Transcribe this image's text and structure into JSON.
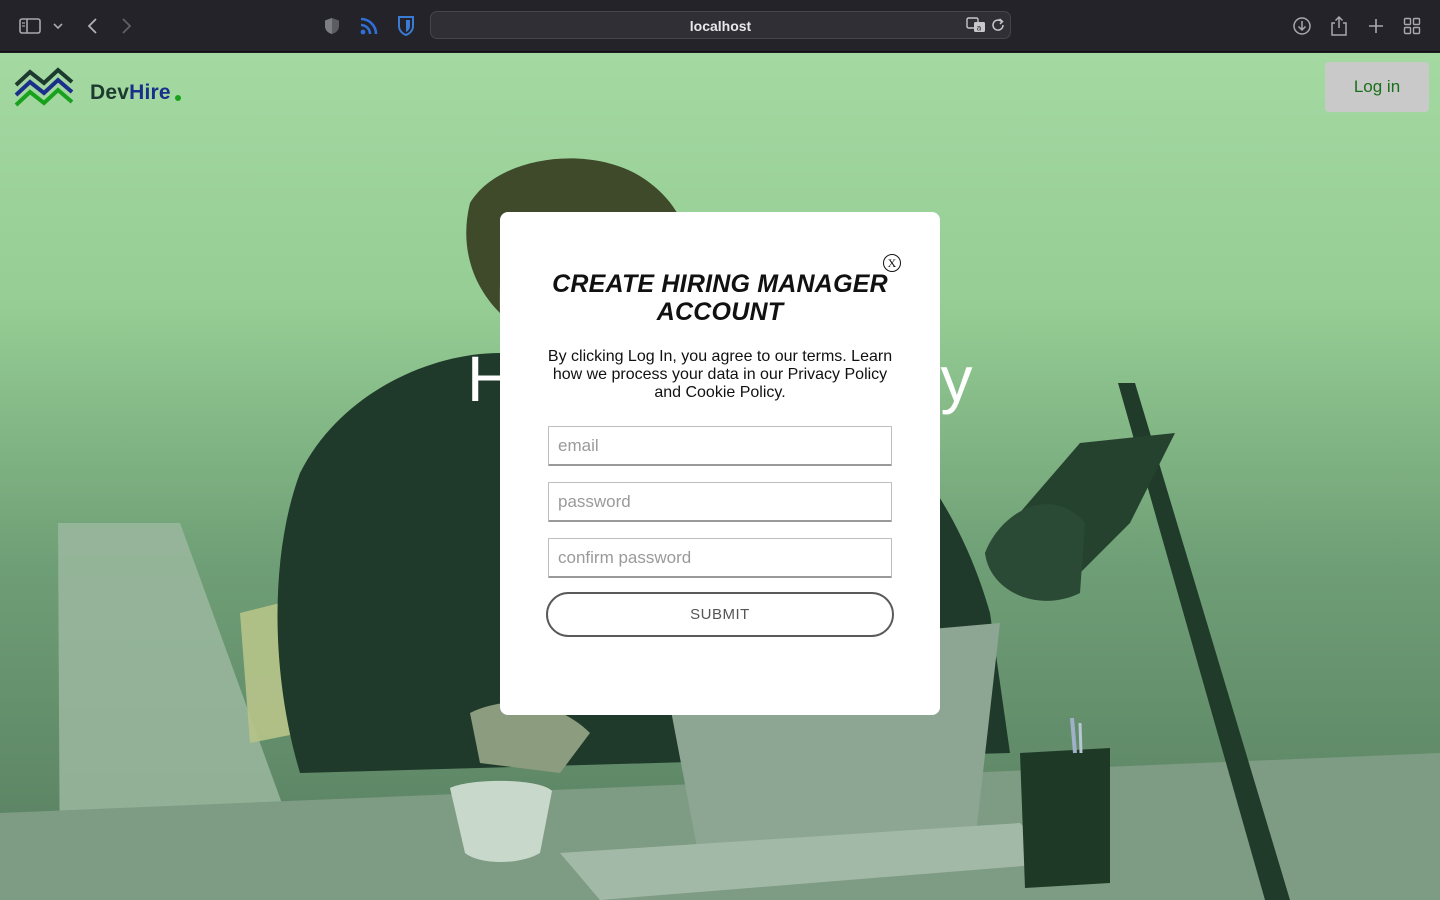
{
  "browser": {
    "url": "localhost",
    "icons": [
      "sidebar-icon",
      "chevron-down-icon",
      "back-icon",
      "forward-icon",
      "shield-icon",
      "rss-icon",
      "bitwarden-icon",
      "translate-icon",
      "reload-icon",
      "download-icon",
      "share-icon",
      "new-tab-icon",
      "tab-overview-icon"
    ]
  },
  "nav": {
    "brand_dev": "Dev",
    "brand_hire": "Hire",
    "login_label": "Log in"
  },
  "hero": {
    "title": "Hiring made easy"
  },
  "modal": {
    "close_label": "X",
    "title": "CREATE HIRING MANAGER ACCOUNT",
    "terms": "By clicking Log In, you agree to our terms. Learn how we process your data in our Privacy Policy and Cookie Policy.",
    "email_placeholder": "email",
    "password_placeholder": "password",
    "confirm_placeholder": "confirm password",
    "submit_label": "SUBMIT"
  },
  "colors": {
    "page_green": "#a4d9a2",
    "brand_dark": "#1c3a2e",
    "brand_blue": "#1a2f8a",
    "brand_green": "#18a11d",
    "login_bg": "#c9c9c9",
    "login_text": "#1a6f1a"
  }
}
